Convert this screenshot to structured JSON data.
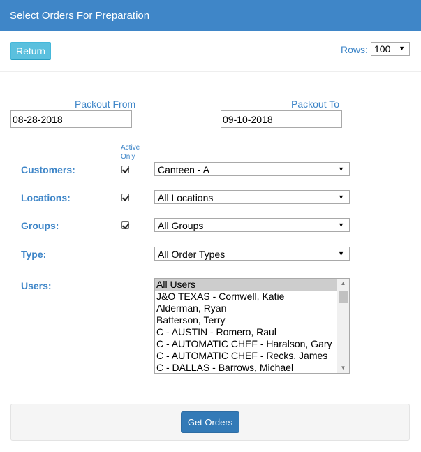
{
  "header": {
    "title": "Select Orders For Preparation"
  },
  "toolbar": {
    "return_label": "Return",
    "rows_label": "Rows:",
    "rows_value": "100"
  },
  "dates": {
    "from_label": "Packout From",
    "from_value": "08-28-2018",
    "to_label": "Packout To",
    "to_value": "09-10-2018"
  },
  "filters": {
    "active_only_line1": "Active",
    "active_only_line2": "Only",
    "customers": {
      "label": "Customers:",
      "value": "Canteen - A",
      "active_only": true
    },
    "locations": {
      "label": "Locations:",
      "value": "All Locations",
      "active_only": true
    },
    "groups": {
      "label": "Groups:",
      "value": "All Groups",
      "active_only": true
    },
    "type": {
      "label": "Type:",
      "value": "All Order Types"
    }
  },
  "users": {
    "label": "Users:",
    "options": [
      "All Users",
      "J&O TEXAS - Cornwell, Katie",
      "Alderman, Ryan",
      "Batterson, Terry",
      "C - AUSTIN - Romero, Raul",
      "C - AUTOMATIC CHEF - Haralson, Gary",
      "C - AUTOMATIC CHEF - Recks, James",
      "C - DALLAS - Barrows, Michael"
    ],
    "selected_index": 0
  },
  "footer": {
    "get_orders_label": "Get Orders"
  },
  "icons": {
    "caret": "▼",
    "scroll_up": "▲",
    "scroll_down": "▼"
  }
}
